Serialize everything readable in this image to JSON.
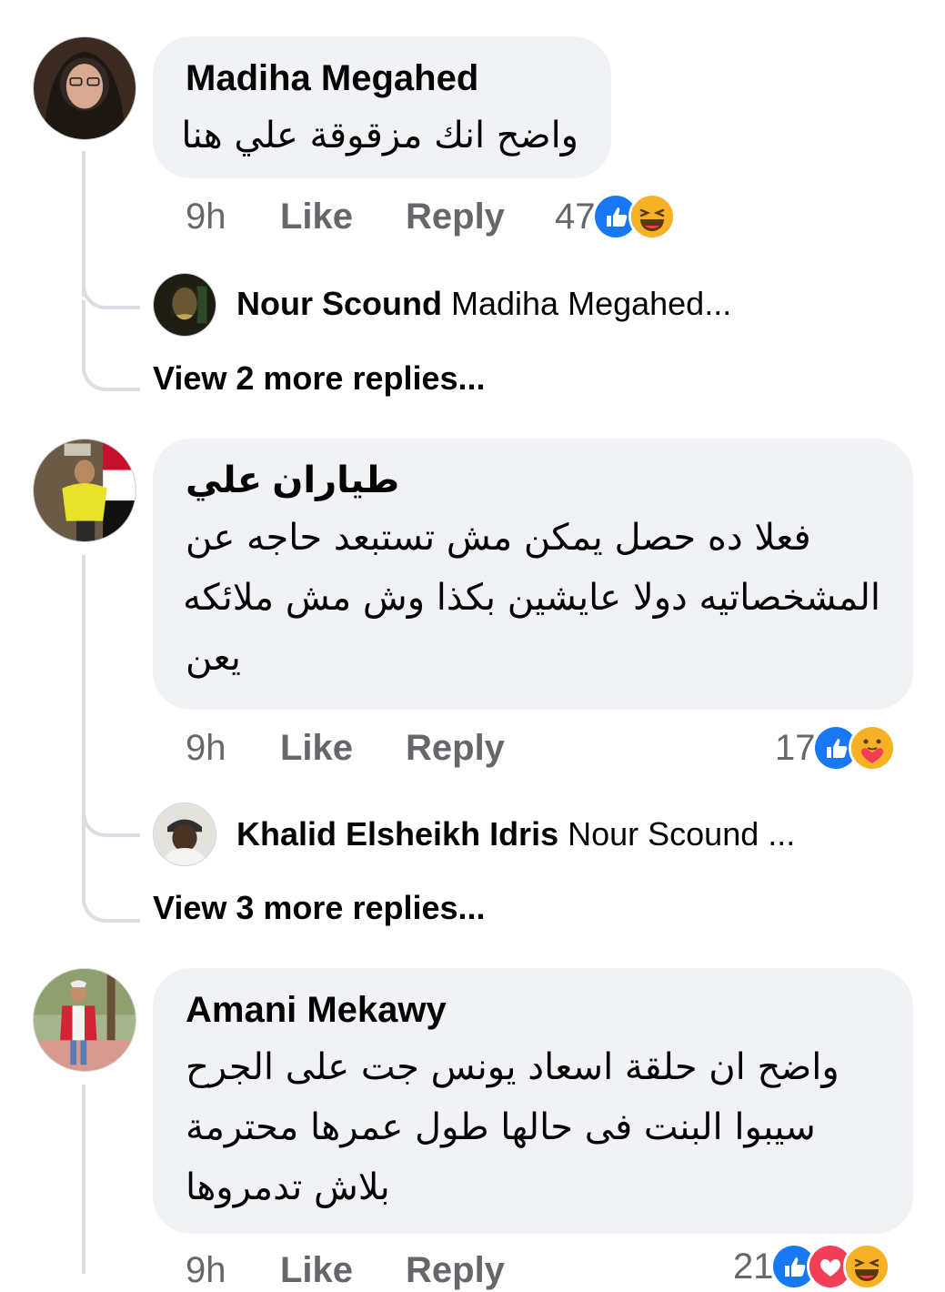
{
  "comments": [
    {
      "author": "Madiha Megahed",
      "lines": [
        "واضح انك مزقوقة علي هنا"
      ],
      "time": "9h",
      "like_label": "Like",
      "reply_label": "Reply",
      "reaction_count": "47",
      "reactions": [
        "like-icon",
        "haha-icon"
      ],
      "reply_preview": {
        "author": "Nour Scound",
        "text": "Madiha Megahed..."
      },
      "more_replies": "View 2 more replies..."
    },
    {
      "author": "طياران علي",
      "lines": [
        "فعلا ده حصل يمكن مش تستبعد حاجه عن",
        "المشخصاتيه دولا عايشين بكذا وش مش ملائكه",
        "يعن"
      ],
      "time": "9h",
      "like_label": "Like",
      "reply_label": "Reply",
      "reaction_count": "17",
      "reactions": [
        "like-icon",
        "care-icon"
      ],
      "reply_preview": {
        "author": "Khalid Elsheikh Idris",
        "text": "Nour Scound ..."
      },
      "more_replies": "View 3 more replies..."
    },
    {
      "author": "Amani Mekawy",
      "lines": [
        "واضح ان حلقة اسعاد يونس جت على الجرح",
        "سيبوا البنت فى حالها طول عمرها محترمة",
        "بلاش تدمروها"
      ],
      "time": "9h",
      "like_label": "Like",
      "reply_label": "Reply",
      "reaction_count": "21",
      "reactions": [
        "like-icon",
        "love-icon",
        "haha-icon"
      ]
    }
  ],
  "colors": {
    "bubble": "#f0f2f5",
    "meta_text": "#65676b",
    "like_blue": "#1877f2",
    "love_red": "#f33e58",
    "haha_yellow": "#f7b125",
    "thread_line": "#dadde1"
  }
}
